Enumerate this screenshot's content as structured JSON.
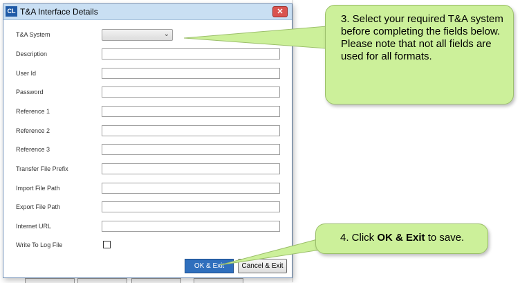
{
  "dialog": {
    "title": "T&A Interface Details",
    "logo_text": "CL",
    "close_glyph": "✕",
    "fields": [
      {
        "label": "T&A System",
        "type": "select",
        "value": ""
      },
      {
        "label": "Description",
        "type": "text",
        "value": ""
      },
      {
        "label": "User Id",
        "type": "text",
        "value": ""
      },
      {
        "label": "Password",
        "type": "text",
        "value": ""
      },
      {
        "label": "Reference 1",
        "type": "text",
        "value": ""
      },
      {
        "label": "Reference 2",
        "type": "text",
        "value": ""
      },
      {
        "label": "Reference 3",
        "type": "text",
        "value": ""
      },
      {
        "label": "Transfer File Prefix",
        "type": "text",
        "value": ""
      },
      {
        "label": "Import File Path",
        "type": "text",
        "value": ""
      },
      {
        "label": "Export File Path",
        "type": "text",
        "value": ""
      },
      {
        "label": "Internet URL",
        "type": "text",
        "value": ""
      },
      {
        "label": "Write To Log File",
        "type": "checkbox",
        "checked": false
      }
    ],
    "buttons": {
      "ok_label": "OK & Exit",
      "cancel_label": "Cancel & Exit"
    }
  },
  "callouts": {
    "step3": "3. Select your required T&A system before completing the fields below. Please note that not all fields are used for all formats.",
    "step4_prefix": "4. Click ",
    "step4_bold": "OK & Exit",
    "step4_suffix": " to save."
  },
  "colors": {
    "callout_fill": "#ccf09a",
    "titlebar": "#c9dff3",
    "ok_button": "#2f6fbd",
    "close_button": "#d9534f"
  }
}
